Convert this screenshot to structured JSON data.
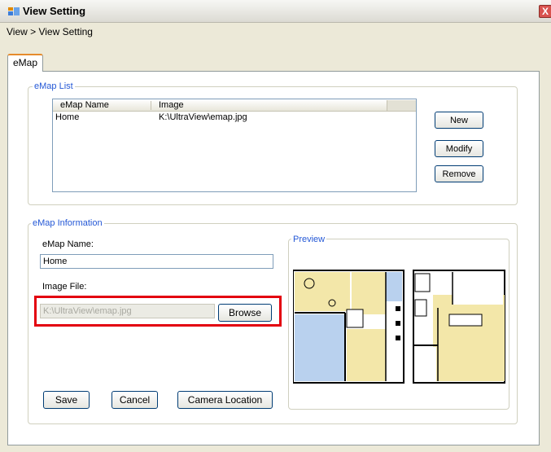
{
  "window": {
    "title": "View Setting",
    "close_label": "X"
  },
  "breadcrumb": "View > View Setting",
  "tabs": [
    {
      "label": "eMap"
    }
  ],
  "emap_list": {
    "legend": "eMap List",
    "columns": [
      "eMap Name",
      "Image"
    ],
    "rows": [
      {
        "name": "Home",
        "image": "K:\\UltraView\\emap.jpg"
      }
    ],
    "buttons": {
      "new": "New",
      "modify": "Modify",
      "remove": "Remove"
    }
  },
  "emap_info": {
    "legend": "eMap Information",
    "name_label": "eMap Name:",
    "name_value": "Home",
    "image_label": "Image File:",
    "image_value": "K:\\UltraView\\emap.jpg",
    "browse_label": "Browse",
    "preview_legend": "Preview",
    "save_label": "Save",
    "cancel_label": "Cancel",
    "camera_label": "Camera Location"
  },
  "colors": {
    "accent": "#2458d6",
    "highlight": "#e3000f",
    "tab_accent": "#e68b2c"
  }
}
